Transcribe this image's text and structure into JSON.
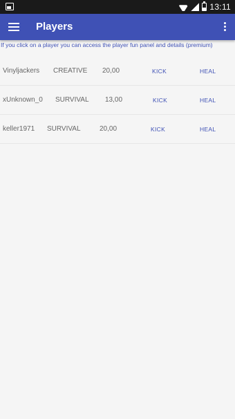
{
  "status_bar": {
    "time": "13:11"
  },
  "app_bar": {
    "title": "Players"
  },
  "info": {
    "text": "If you click on a player you can access the player fun panel and details (premium)"
  },
  "players": [
    {
      "name": "Vinyljackers",
      "mode": "CREATIVE",
      "health": "20,00",
      "kick_label": "KICK",
      "heal_label": "HEAL"
    },
    {
      "name": "xUnknown_0",
      "mode": "SURVIVAL",
      "health": "13,00",
      "kick_label": "KICK",
      "heal_label": "HEAL"
    },
    {
      "name": "keller1971",
      "mode": "SURVIVAL",
      "health": "20,00",
      "kick_label": "KICK",
      "heal_label": "HEAL"
    }
  ],
  "colors": {
    "primary": "#3f51b5",
    "status_bar": "#1a1a1a",
    "background": "#f5f5f5",
    "text_secondary": "#666666"
  }
}
